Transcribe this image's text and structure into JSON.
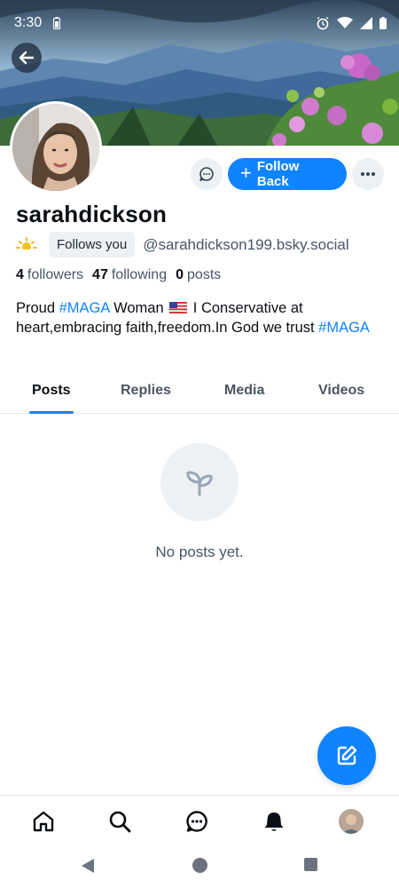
{
  "status_bar": {
    "time": "3:30"
  },
  "profile": {
    "display_name": "sarahdickson",
    "follows_you": "Follows you",
    "handle": "@sarahdickson199.bsky.social",
    "follow_label": "Follow Back",
    "stats": {
      "followers_count": "4",
      "followers_label": "followers",
      "following_count": "47",
      "following_label": "following",
      "posts_count": "0",
      "posts_label": "posts"
    },
    "bio": {
      "part1": "Proud ",
      "tag1": "#MAGA",
      "part2": " Woman ",
      "part3": " I Conservative at heart,embracing faith,freedom.In God we trust ",
      "tag2": "#MAGA"
    }
  },
  "tabs": [
    {
      "label": "Posts",
      "active": true
    },
    {
      "label": "Replies",
      "active": false
    },
    {
      "label": "Media",
      "active": false
    },
    {
      "label": "Videos",
      "active": false
    }
  ],
  "empty_state": {
    "text": "No posts yet.",
    "icon": "seedling-icon"
  },
  "bottom_nav": [
    "home-icon",
    "search-icon",
    "chat-icon",
    "bell-icon",
    "avatar"
  ],
  "colors": {
    "accent": "#1083fe",
    "muted": "#475569",
    "chip_bg": "#eef1f4"
  }
}
